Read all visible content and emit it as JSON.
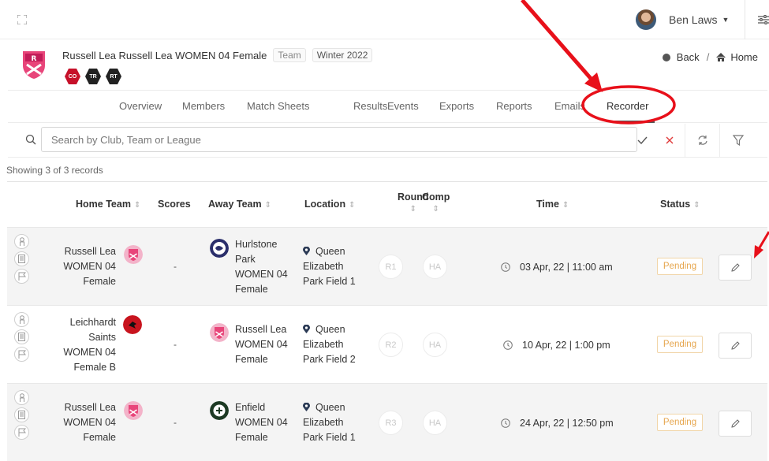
{
  "user": {
    "name": "Ben Laws"
  },
  "team": {
    "title": "Russell Lea Russell Lea WOMEN 04 Female",
    "type_tag": "Team",
    "season_tag": "Winter 2022",
    "roles": [
      "CO",
      "TR",
      "RT"
    ]
  },
  "breadcrumb": {
    "back": "Back",
    "separator": "/",
    "home": "Home"
  },
  "tabs": [
    "Overview",
    "Members",
    "Match Sheets",
    "Results",
    "Events",
    "Exports",
    "Reports",
    "Emails",
    "Recorder"
  ],
  "active_tab": "Recorder",
  "search": {
    "placeholder": "Search by Club, Team or League",
    "value": ""
  },
  "showing": "Showing 3 of 3 records",
  "columns": {
    "home": "Home Team",
    "scores": "Scores",
    "away": "Away Team",
    "location": "Location",
    "round": "Round",
    "comp": "Comp",
    "time": "Time",
    "status": "Status"
  },
  "rows": [
    {
      "home": [
        "Russell Lea",
        "WOMEN 04",
        "Female"
      ],
      "score": "-",
      "away": [
        "Hurlstone",
        "Park",
        "WOMEN 04",
        "Female"
      ],
      "location": [
        "Queen",
        "Elizabeth",
        "Park Field 1"
      ],
      "round": "R1",
      "comp": "HA",
      "time": "03 Apr, 22 | 11:00 am",
      "status": "Pending"
    },
    {
      "home": [
        "Leichhardt",
        "Saints",
        "WOMEN 04",
        "Female B"
      ],
      "score": "-",
      "away": [
        "Russell Lea",
        "WOMEN 04",
        "Female"
      ],
      "location": [
        "Queen",
        "Elizabeth",
        "Park Field 2"
      ],
      "round": "R2",
      "comp": "HA",
      "time": "10 Apr, 22 | 1:00 pm",
      "status": "Pending"
    },
    {
      "home": [
        "Russell Lea",
        "WOMEN 04",
        "Female"
      ],
      "score": "-",
      "away": [
        "Enfield",
        "WOMEN 04",
        "Female"
      ],
      "location": [
        "Queen",
        "Elizabeth",
        "Park Field 1"
      ],
      "round": "R3",
      "comp": "HA",
      "time": "24 Apr, 22 | 12:50 pm",
      "status": "Pending"
    }
  ],
  "colors": {
    "annotation": "#e8101a",
    "pending": "#e6a64e",
    "role_co": "#c6112a"
  },
  "icons": [
    "expand-icon",
    "filter-settings-icon",
    "search-icon",
    "check-icon",
    "clear-icon",
    "refresh-icon",
    "filter-icon",
    "team-sheet-icon",
    "notes-icon",
    "flag-icon",
    "location-pin-icon",
    "clock-icon",
    "edit-icon",
    "home-icon"
  ]
}
